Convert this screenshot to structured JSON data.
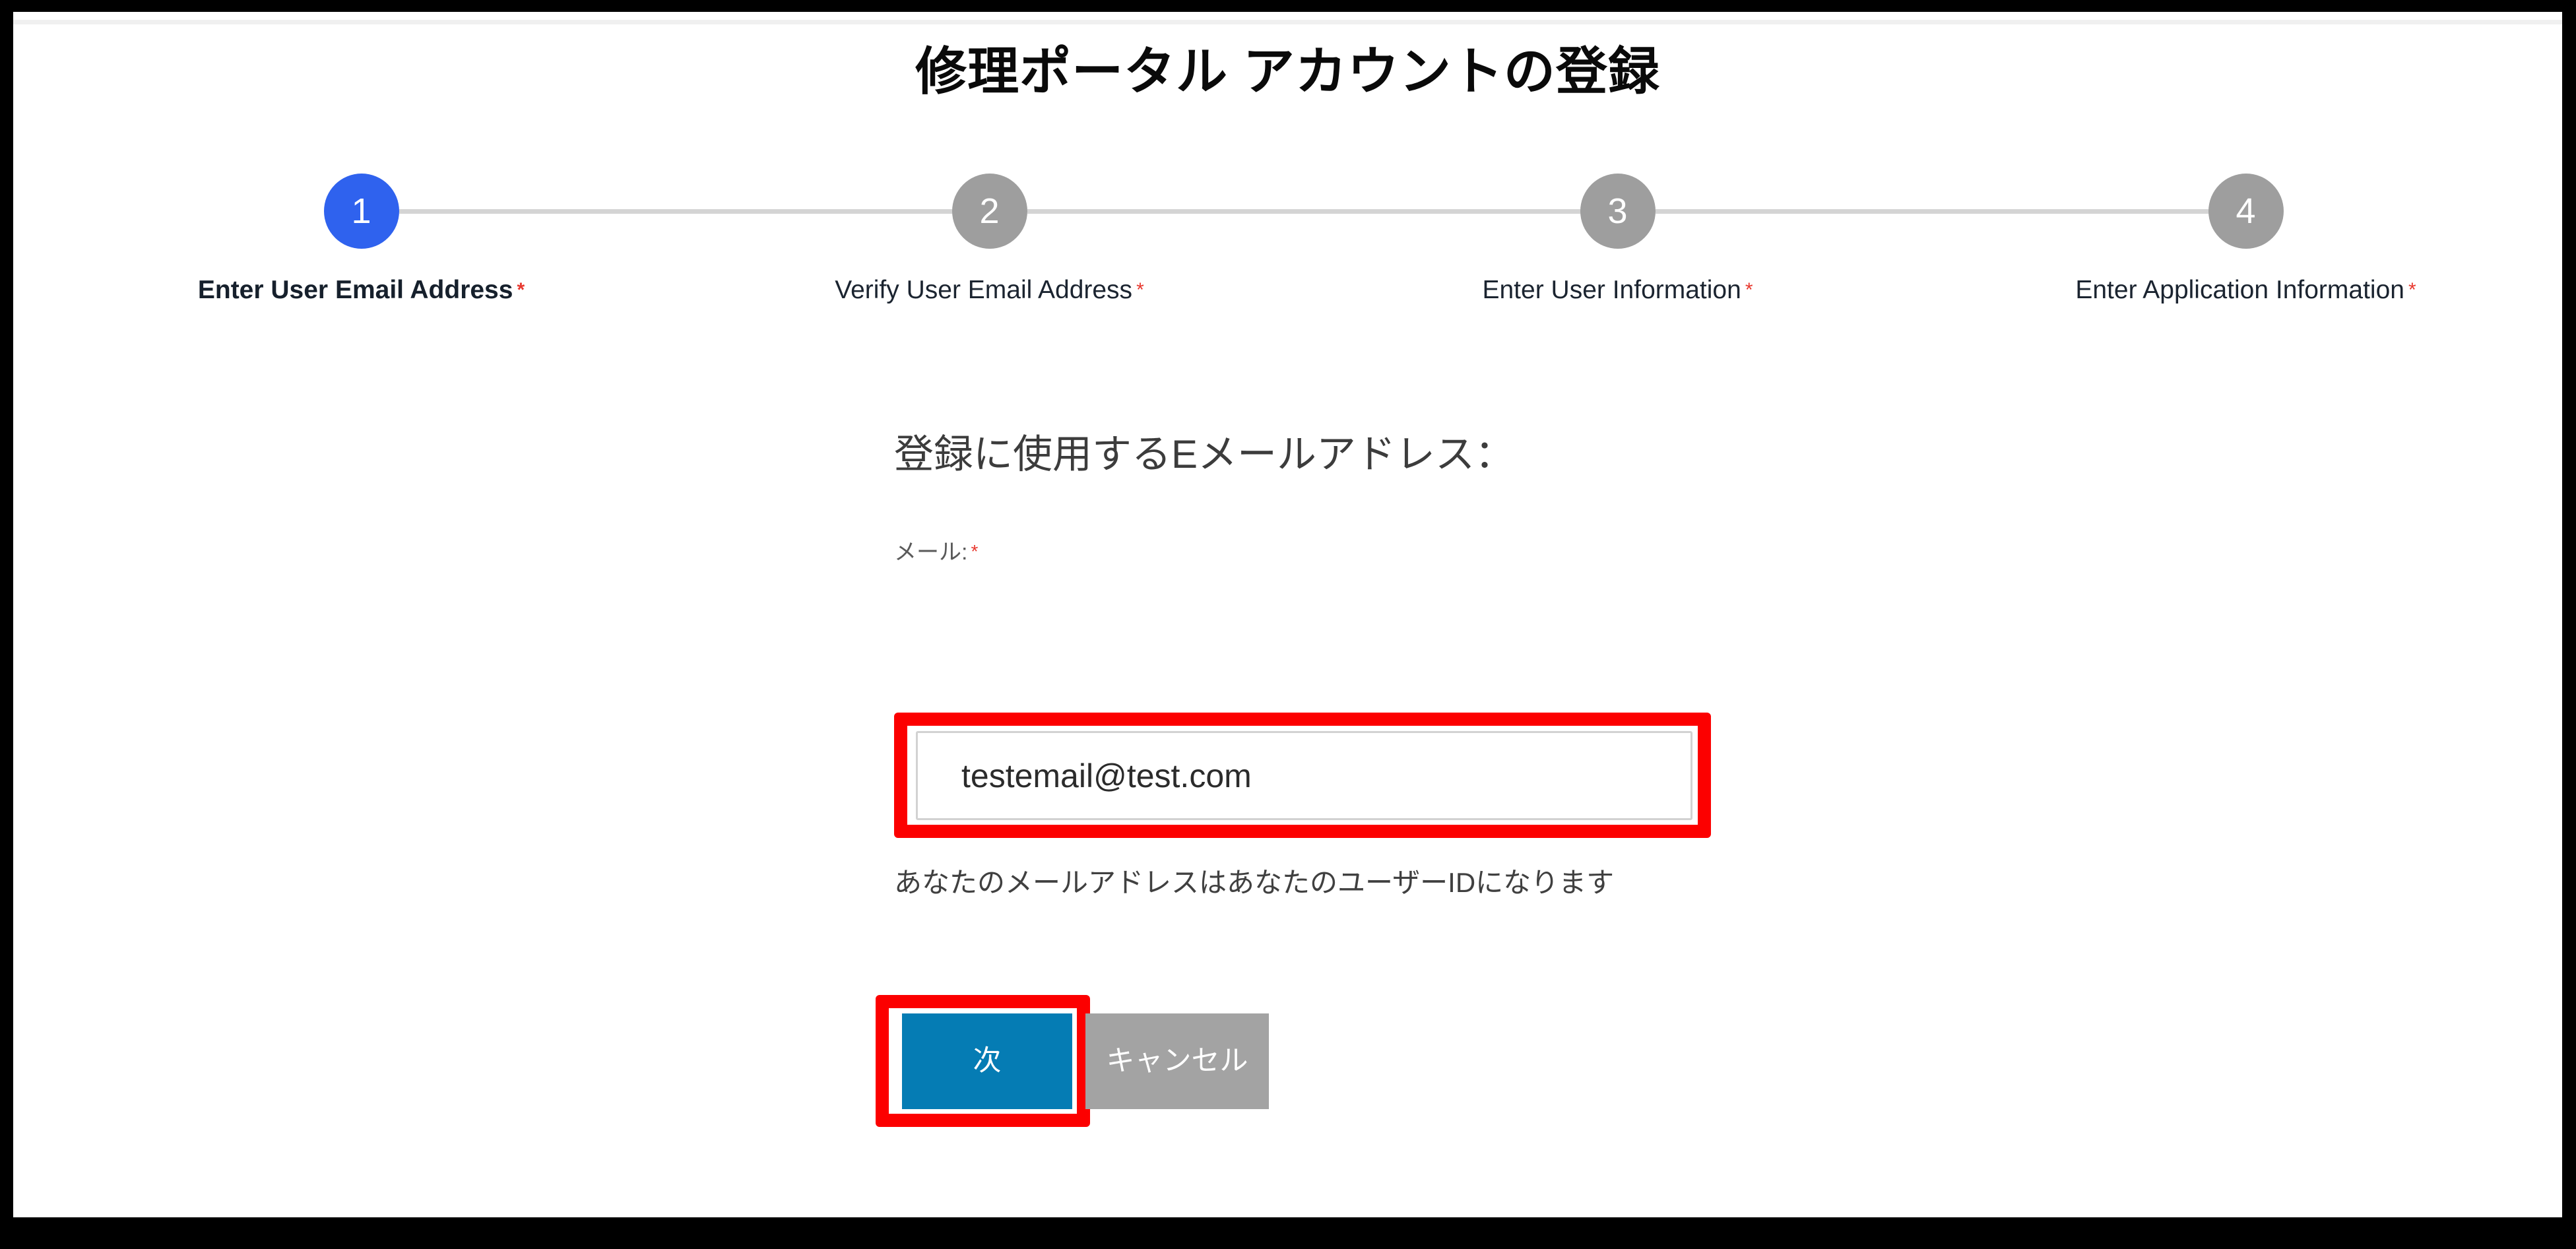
{
  "page": {
    "title": "修理ポータル アカウントの登録",
    "required_marker": "*"
  },
  "stepper": {
    "steps": [
      {
        "number": "1",
        "label": "Enter User Email Address",
        "required": "*",
        "state": "active"
      },
      {
        "number": "2",
        "label": "Verify User Email Address",
        "required": "*",
        "state": "inactive"
      },
      {
        "number": "3",
        "label": "Enter User Information",
        "required": "*",
        "state": "inactive"
      },
      {
        "number": "4",
        "label": "Enter Application Information",
        "required": "*",
        "state": "inactive"
      }
    ],
    "active_step": "1",
    "active_color": "#2f62ee",
    "inactive_color": "#9e9e9e",
    "connector_color": "#d4d4d4"
  },
  "form": {
    "heading": "登録に使用するEメールアドレス：",
    "email_label": "メール:",
    "email_required": "*",
    "email_value": "testemail@test.com",
    "email_placeholder": "",
    "hint": "あなたのメールアドレスはあなたのユーザーIDになります"
  },
  "buttons": {
    "next_label": "次",
    "next_color": "#057cb4",
    "cancel_label": "キャンセル",
    "cancel_color": "#a3a3a3"
  },
  "annotations": {
    "color": "#fc0000",
    "email_field_highlight": "email-input",
    "next_button_highlight": "next-button"
  }
}
